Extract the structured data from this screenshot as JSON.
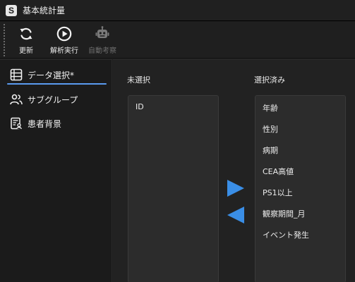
{
  "window": {
    "title": "基本統計量",
    "logo_letter": "S"
  },
  "toolbar": {
    "refresh_label": "更新",
    "run_label": "解析実行",
    "auto_label": "自動考察"
  },
  "sidebar": {
    "items": [
      {
        "label": "データ選択*",
        "icon": "table-icon",
        "active": true
      },
      {
        "label": "サブグループ",
        "icon": "users-icon",
        "active": false
      },
      {
        "label": "患者背景",
        "icon": "patient-report-icon",
        "active": false
      }
    ]
  },
  "main": {
    "unselected_label": "未選択",
    "selected_label": "選択済み",
    "unselected_items": [
      "ID"
    ],
    "selected_items": [
      "年齢",
      "性別",
      "病期",
      "CEA高値",
      "PS1以上",
      "観察期間_月",
      "イベント発生"
    ]
  },
  "colors": {
    "accent": "#3a8ee6",
    "tab_underline": "#5a9bf0",
    "disabled_text": "#6f6f6f"
  }
}
